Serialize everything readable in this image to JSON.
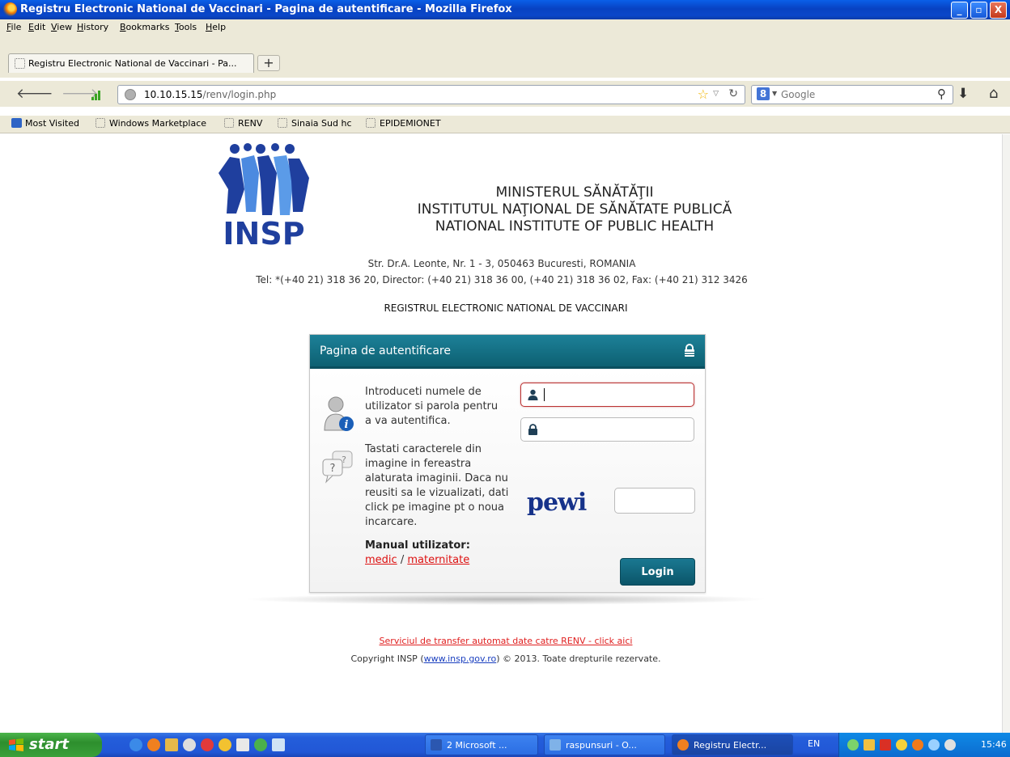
{
  "window": {
    "title": "Registru Electronic National de Vaccinari - Pagina de autentificare - Mozilla Firefox",
    "controls": [
      "_",
      "▫",
      "X"
    ]
  },
  "menu": [
    "File",
    "Edit",
    "View",
    "History",
    "Bookmarks",
    "Tools",
    "Help"
  ],
  "tab": {
    "label": "Registru Electronic National de Vaccinari - Pa...",
    "new_tab": "+"
  },
  "nav": {
    "url_host": "10.10.15.15",
    "url_path": "/renv/login.php",
    "search_placeholder": "Google"
  },
  "bookmarks": [
    "Most Visited",
    "Windows Marketplace",
    "RENV",
    "Sinaia Sud hc",
    "EPIDEMIONET"
  ],
  "header": {
    "logo_text": "INSP",
    "ministry": "MINISTERUL SĂNĂTĂŢII",
    "institute_ro": "INSTITUTUL NAŢIONAL DE SĂNĂTATE PUBLICĂ",
    "institute_en": "NATIONAL INSTITUTE OF PUBLIC HEALTH",
    "address": "Str. Dr.A. Leonte, Nr. 1 - 3, 050463 Bucuresti, ROMANIA",
    "phones": "Tel: *(+40 21) 318 36 20, Director: (+40 21) 318 36 00, (+40 21) 318 36 02, Fax: (+40 21) 312 3426",
    "registry_title": "REGISTRUL ELECTRONIC NATIONAL DE VACCINARI"
  },
  "login": {
    "title": "Pagina de autentificare",
    "instructions": "Introduceti numele de utilizator si parola pentru a va autentifica.",
    "captcha_instructions": "Tastati caracterele din imagine in fereastra alaturata imaginii. Daca nu reusiti sa le vizualizati, dati click pe imagine pt o noua incarcare.",
    "manual_label": "Manual utilizator:",
    "manual_links": [
      "medic",
      "maternitate"
    ],
    "manual_separator": " / ",
    "username_value": "",
    "password_value": "",
    "captcha_text": "pewi",
    "captcha_value": "",
    "button": "Login"
  },
  "footer": {
    "transfer_link": "Serviciul de transfer automat date catre RENV - click aici",
    "copyright_prefix": "Copyright INSP (",
    "copyright_link": "www.insp.gov.ro",
    "copyright_suffix": ") © 2013. Toate drepturile rezervate."
  },
  "taskbar": {
    "start": "start",
    "tasks": [
      "2 Microsoft ...",
      "raspunsuri - O...",
      "Registru Electr..."
    ],
    "language": "EN",
    "clock": "15:46"
  },
  "colors": {
    "panel_header": "#0d6072",
    "login_button": "#0b5569",
    "link_red": "#d11111",
    "logo_blue": "#1f3f9e"
  }
}
